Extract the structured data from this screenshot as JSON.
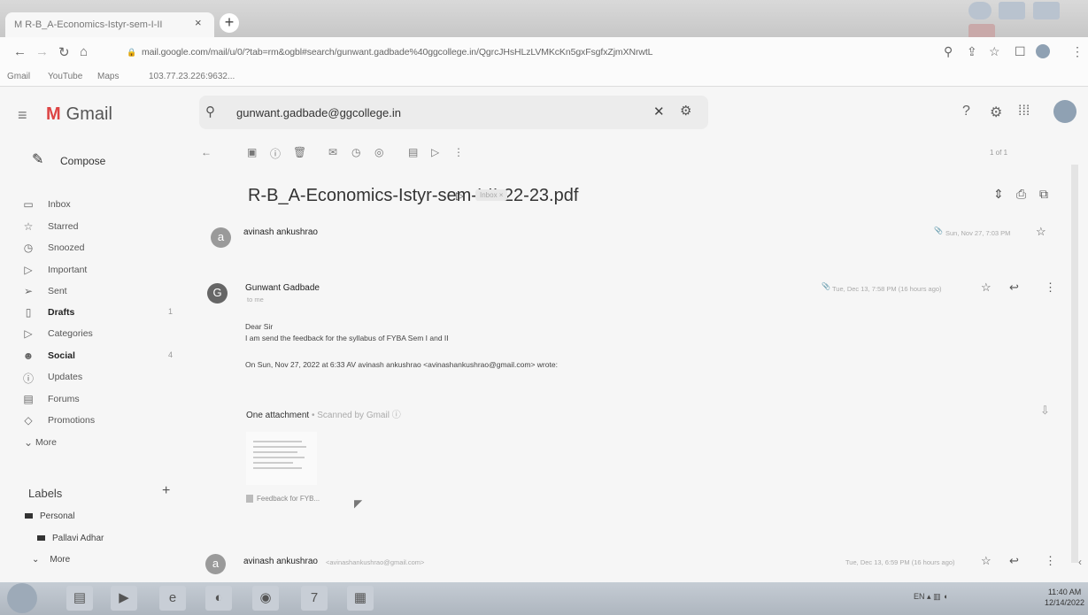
{
  "browser": {
    "tab_title": "M R-B_A-Economics-Istyr-sem-I-II",
    "url": "mail.google.com/mail/u/0/?tab=rm&ogbl#search/gunwant.gadbade%40ggcollege.in/QgrcJHsHLzLVMKcKn5gxFsgfxZjmXNrwtL",
    "bookmarks": [
      "Gmail",
      "YouTube",
      "Maps",
      "103.77.23.226:9632..."
    ]
  },
  "gmail": {
    "app_name": "Gmail",
    "search_value": "gunwant.gadbade@ggcollege.in",
    "compose_label": "Compose",
    "nav": [
      {
        "label": "Inbox",
        "icon": "inbox-icon"
      },
      {
        "label": "Starred",
        "icon": "star-icon"
      },
      {
        "label": "Snoozed",
        "icon": "clock-icon"
      },
      {
        "label": "Important",
        "icon": "important-icon"
      },
      {
        "label": "Sent",
        "icon": "send-icon"
      },
      {
        "label": "Drafts",
        "icon": "draft-icon",
        "count": "1"
      },
      {
        "label": "Categories",
        "icon": "label-icon"
      },
      {
        "label": "Social",
        "icon": "people-icon",
        "count": "4"
      },
      {
        "label": "Updates",
        "icon": "info-icon"
      },
      {
        "label": "Forums",
        "icon": "forum-icon"
      },
      {
        "label": "Promotions",
        "icon": "tag-icon"
      },
      {
        "label": "More",
        "icon": "chevron-down-icon"
      }
    ],
    "labels_title": "Labels",
    "labels": [
      "Personal",
      "Pallavi Adhar",
      "More"
    ]
  },
  "thread": {
    "pager": "1 of 1",
    "subject": "R-B_A-Economics-Istyr-sem-I-II-22-23.pdf",
    "inbox_chip": "Inbox ×",
    "messages": [
      {
        "sender": "avinash ankushrao",
        "date": "Sun, Nov 27, 7:03 PM",
        "initial": "a"
      },
      {
        "sender": "Gunwant Gadbade",
        "date": "Tue, Dec 13, 7:58 PM (16 hours ago)",
        "initial": "G",
        "to": "to me"
      },
      {
        "sender": "avinash ankushrao",
        "sender_email": "<avinashankushrao@gmail.com>",
        "date": "Tue, Dec 13, 6:59 PM (16 hours ago)",
        "initial": "a"
      }
    ],
    "body": {
      "greeting": "Dear Sir",
      "line1": "I am send the feedback for the syllabus of FYBA Sem I and II",
      "quote": "On Sun, Nov 27, 2022 at 6:33 AV avinash ankushrao <avinashankushrao@gmail.com> wrote:"
    },
    "attachment": {
      "title": "One attachment",
      "scan": "• Scanned by Gmail ⓘ",
      "filename": "Feedback for FYB..."
    }
  },
  "taskbar": {
    "tray": "EN",
    "time": "11:40 AM",
    "date": "12/14/2022"
  }
}
